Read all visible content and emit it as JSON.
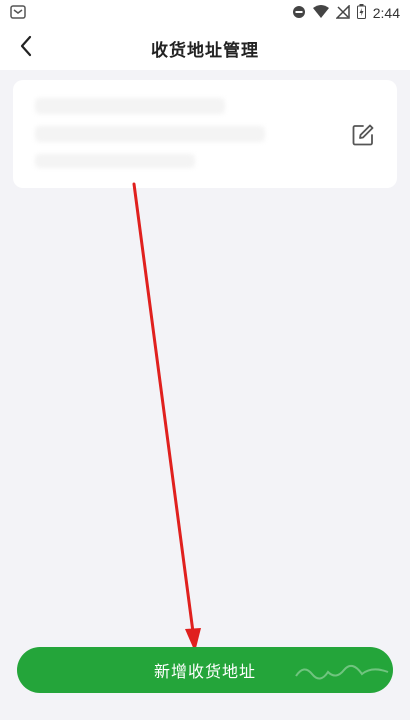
{
  "status_bar": {
    "time": "2:44",
    "icons": [
      "notification-icon",
      "do-not-disturb-icon",
      "wifi-icon",
      "no-signal-icon",
      "battery-icon"
    ]
  },
  "header": {
    "title": "收货地址管理",
    "back_icon": "chevron-left-icon"
  },
  "address_card": {
    "edit_icon": "edit-icon"
  },
  "footer": {
    "add_button_label": "新增收货地址"
  },
  "colors": {
    "primary_green": "#24a53a",
    "background": "#f3f3f7",
    "arrow_red": "#e0201e"
  }
}
